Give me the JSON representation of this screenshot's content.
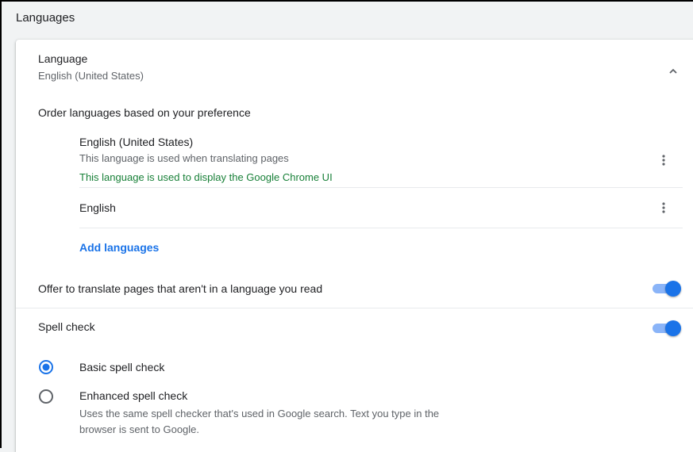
{
  "section": {
    "title": "Languages"
  },
  "language": {
    "title": "Language",
    "current": "English (United States)"
  },
  "order": {
    "label": "Order languages based on your preference",
    "items": [
      {
        "name": "English (United States)",
        "description": "This language is used when translating pages",
        "ui_note": "This language is used to display the Google Chrome UI"
      },
      {
        "name": "English"
      }
    ],
    "add_label": "Add languages"
  },
  "translate": {
    "label": "Offer to translate pages that aren't in a language you read",
    "enabled": true
  },
  "spellcheck": {
    "label": "Spell check",
    "enabled": true,
    "options": [
      {
        "label": "Basic spell check",
        "selected": true
      },
      {
        "label": "Enhanced spell check",
        "description_line1": "Uses the same spell checker that's used in Google search. Text you type in the",
        "description_line2": "browser is sent to Google.",
        "selected": false
      }
    ]
  },
  "icons": {
    "chevron": "chevron-up-icon",
    "more": "more-vert-icon"
  },
  "colors": {
    "accent": "#1a73e8",
    "toggle_track": "#8ab4f8",
    "success_text": "#188038",
    "secondary_text": "#5f6368"
  }
}
